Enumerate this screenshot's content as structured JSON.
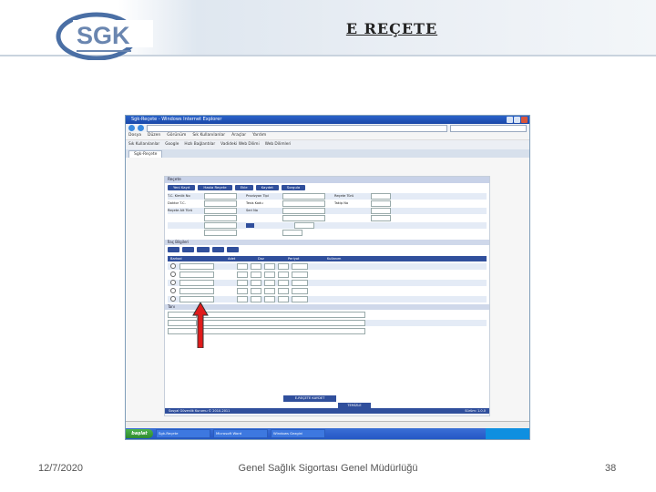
{
  "slide": {
    "title": "E REÇETE",
    "date": "12/7/2020",
    "organization": "Genel Sağlık Sigortası Genel Müdürlüğü",
    "page_number": "38"
  },
  "logo": {
    "text": "SGK",
    "colors": {
      "ring": "#4a6fa5",
      "text": "#6a86b0"
    }
  },
  "browser": {
    "title": "Sgk-Reçete - Windows Internet Explorer",
    "menu": [
      "Dosya",
      "Düzen",
      "Görünüm",
      "Sık Kullanılanlar",
      "Araçlar",
      "Yardım"
    ],
    "favorites": [
      "Sık Kullanılanlar",
      "Google",
      "Hızlı Bağlantılar",
      "Vadideki Web Dilimi",
      "Web Dilimleri"
    ],
    "tab": "Sgk-Reçete"
  },
  "eprescription": {
    "header": "Reçete",
    "buttons": [
      "Yeni Kayıt",
      "Hasta Reçete",
      "Ekle",
      "Kaydet",
      "Sorgula"
    ],
    "fields": [
      "T.C. Kimlik No",
      "Provizyon Tipi",
      "Reçete Türü",
      "Doktor T.C.",
      "Tesis Kodu",
      "Takip No",
      "Reçete Alt Türü",
      "Seri No"
    ],
    "drug_section": "İlaç Bilgileri",
    "drug_columns": [
      "Barkod",
      "Adet",
      "Doz",
      "Periyot",
      "Kullanım"
    ],
    "drug_rows": 5,
    "diagnosis_section": "Tanı",
    "save_button": "E-REÇETE KAYDET",
    "clear_button": "TEMİZLE",
    "footer_left": "Sosyal Güvenlik Kurumu © 2010-2011",
    "footer_right": "Sürüm: 1.0.0"
  },
  "taskbar": {
    "start": "başlat",
    "items": [
      "Sgk-Reçete",
      "Microsoft Word",
      "Windows Gezgini"
    ]
  }
}
